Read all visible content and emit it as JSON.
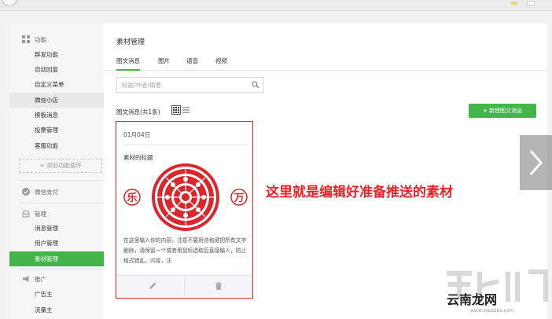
{
  "sidebar": {
    "group_function": "功能",
    "function_items": [
      "群发功能",
      "自动回复",
      "自定义菜单",
      "微信小店",
      "模板消息",
      "投票管理",
      "客服功能"
    ],
    "add_plugin": "+ 添加功能插件",
    "group_pay": "微信支付",
    "group_manage": "管理",
    "manage_items": [
      "消息管理",
      "用户管理",
      "素材管理"
    ],
    "group_promote": "推广",
    "promote_items": [
      "广告主",
      "流量主"
    ]
  },
  "main": {
    "title": "素材管理",
    "tabs": [
      "图文消息",
      "图片",
      "语音",
      "视频"
    ],
    "search_placeholder": "标题/作者/摘要",
    "count_label": "图文消息(共1条)",
    "new_button": "+ 新建图文消息"
  },
  "card": {
    "date": "01月04日",
    "title": "素材的标题",
    "left_char": "乐",
    "right_char": "万",
    "description": "在这里输入你的内容，注意不要用退格键把所有文字删除，请保留一个或者用鼠标选取后直接输入，防止格式错乱。内容，注"
  },
  "annotation": "这里就是编辑好准备推送的素材",
  "watermark": {
    "text": "云南龙网",
    "url": "www.xiazaiba.com"
  },
  "colors": {
    "accent_green": "#44b549",
    "annotation_red": "#e8232a",
    "border_red": "#d9272e"
  }
}
